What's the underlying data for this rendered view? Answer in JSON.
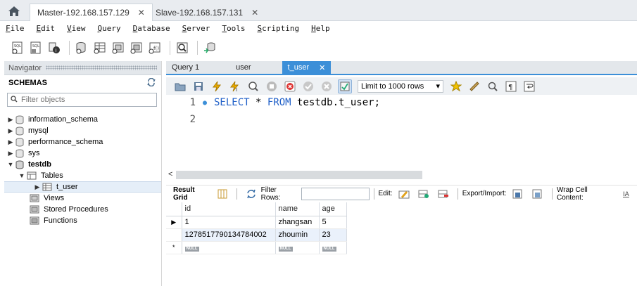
{
  "connection_tabs": [
    {
      "label": "Master-192.168.157.129",
      "active": true
    },
    {
      "label": "Slave-192.168.157.131",
      "active": false
    }
  ],
  "menu": [
    "File",
    "Edit",
    "View",
    "Query",
    "Database",
    "Server",
    "Tools",
    "Scripting",
    "Help"
  ],
  "navigator": {
    "title": "Navigator",
    "schemas_label": "SCHEMAS",
    "filter_placeholder": "Filter objects",
    "schemas": [
      "information_schema",
      "mysql",
      "performance_schema",
      "sys"
    ],
    "expanded_schema": "testdb",
    "tables_label": "Tables",
    "table": "t_user",
    "views_label": "Views",
    "procs_label": "Stored Procedures",
    "funcs_label": "Functions"
  },
  "query_tabs": [
    {
      "label": "Query 1"
    },
    {
      "label": "user"
    },
    {
      "label": "t_user",
      "active": true
    }
  ],
  "editor_toolbar": {
    "limit_label": "Limit to 1000 rows"
  },
  "editor": {
    "lines": [
      {
        "no": "1",
        "kw1": "SELECT",
        "mid": " * ",
        "kw2": "FROM",
        "rest": " testdb.t_user;"
      },
      {
        "no": "2"
      }
    ]
  },
  "result_toolbar": {
    "result_grid": "Result Grid",
    "filter_rows": "Filter Rows:",
    "edit": "Edit:",
    "export_import": "Export/Import:",
    "wrap_cell": "Wrap Cell Content:"
  },
  "grid": {
    "columns": [
      "id",
      "name",
      "age"
    ],
    "rows": [
      [
        "1",
        "zhangsan",
        "5"
      ],
      [
        "1278517790134784002",
        "zhoumin",
        "23"
      ]
    ],
    "null_label": "NULL"
  },
  "colors": {
    "accent": "#3c8fd8",
    "selection": "#eaf1fb"
  }
}
